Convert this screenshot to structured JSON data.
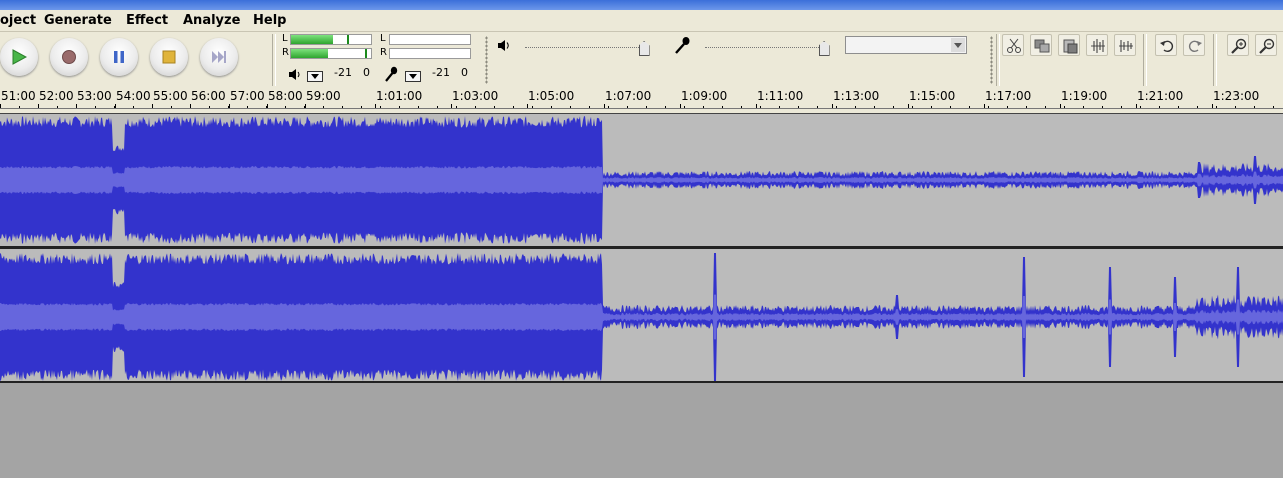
{
  "menu": {
    "items": [
      {
        "label": "oject"
      },
      {
        "label": "Generate"
      },
      {
        "label": "Effect"
      },
      {
        "label": "Analyze"
      },
      {
        "label": "Help"
      }
    ]
  },
  "transport": {
    "buttons": [
      {
        "icon": "play-icon"
      },
      {
        "icon": "record-icon"
      },
      {
        "icon": "pause-icon"
      },
      {
        "icon": "stop-icon"
      },
      {
        "icon": "skip-to-end-icon"
      }
    ]
  },
  "meters": {
    "playback": {
      "left_label": "L",
      "right_label": "R",
      "db_min": "-21",
      "db_max": "0",
      "left_level": 0.52,
      "right_level": 0.46
    },
    "recording": {
      "left_label": "L",
      "right_label": "R",
      "db_min": "-21",
      "db_max": "0",
      "left_level": 0,
      "right_level": 0
    }
  },
  "mixer": {
    "playback_volume": 0.98,
    "recording_volume": 0.98,
    "input_source": ""
  },
  "ruler": {
    "labels": [
      "51:00",
      "52:00",
      "53:00",
      "54:00",
      "55:00",
      "56:00",
      "57:00",
      "58:00",
      "59:00",
      "1:01:00",
      "1:03:00",
      "1:05:00",
      "1:07:00",
      "1:09:00",
      "1:11:00",
      "1:13:00",
      "1:15:00",
      "1:17:00",
      "1:19:00",
      "1:21:00",
      "1:23:00"
    ]
  },
  "colors": {
    "waveform": "#3333cc",
    "waveform_rms": "#6666dd",
    "track_bg": "#bbbbbb"
  }
}
